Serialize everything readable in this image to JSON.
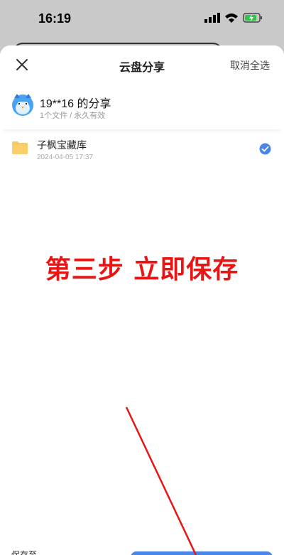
{
  "status": {
    "time": "16:19"
  },
  "header": {
    "title": "云盘分享",
    "deselect_all": "取消全选"
  },
  "share": {
    "owner": "19**16 的分享",
    "meta": "1个文件 / 永久有效"
  },
  "files": [
    {
      "name": "子枫宝藏库",
      "date": "2024-04-05 17:37",
      "selected": true
    }
  ],
  "annotation": "第三步 立即保存",
  "footer": {
    "save_to_label": "保存至"
  },
  "colors": {
    "accent": "#4a86e8",
    "annotation": "#e81515",
    "folder": "#f9c95b"
  }
}
